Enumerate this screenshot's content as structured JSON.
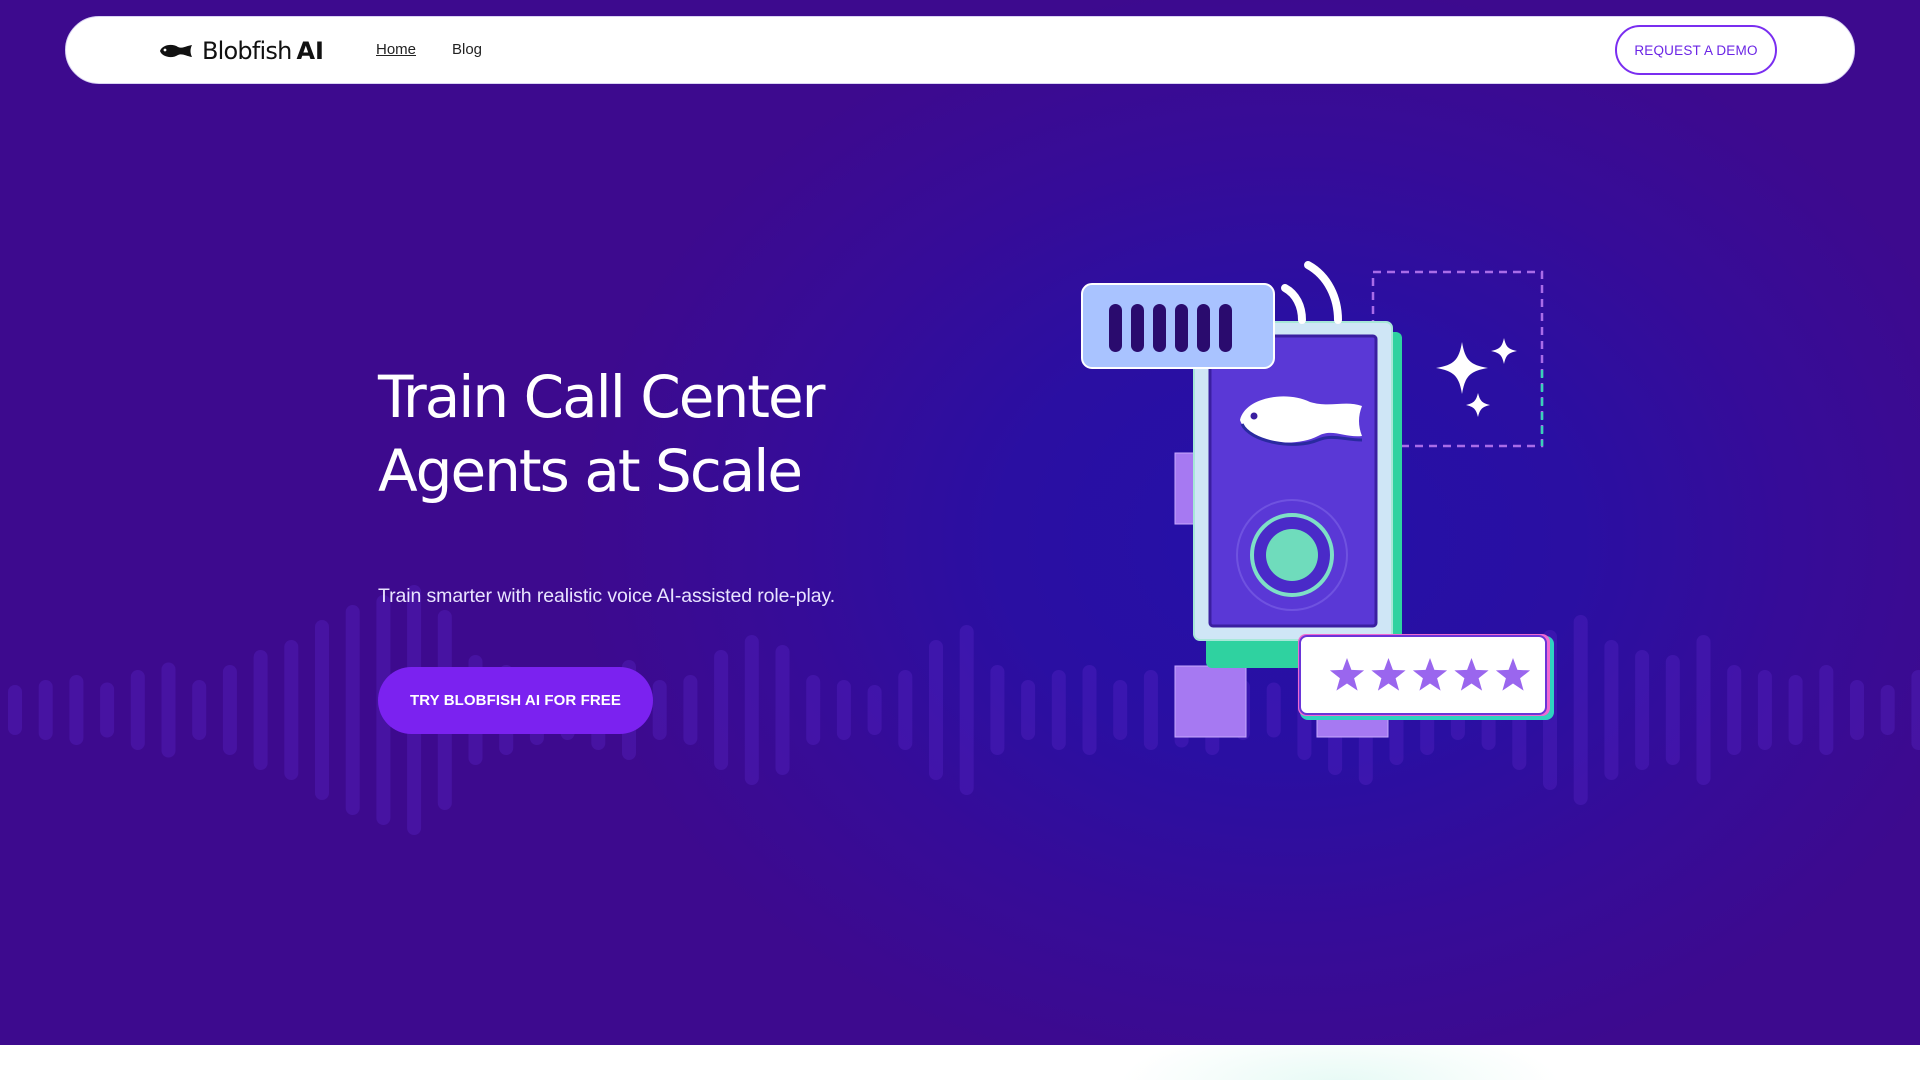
{
  "brand": {
    "name": "Blobfish",
    "suffix": "AI"
  },
  "nav": {
    "home": "Home",
    "blog": "Blog",
    "demo_button": "REQUEST A DEMO"
  },
  "hero": {
    "title_line1": "Train Call Center",
    "title_line2": "Agents at Scale",
    "subtitle": "Train smarter with realistic voice AI-assisted role-play.",
    "cta": "TRY BLOBFISH AI FOR FREE"
  },
  "illustration": {
    "rating_stars": 5
  },
  "colors": {
    "hero_background": "#3a0b92",
    "accent_purple": "#7b22f0",
    "phone_screen": "#5a38d6",
    "phone_frame_mint": "#2fd2a0",
    "speech_bubble": "#a9c3ff",
    "checker_purple": "#a679f2"
  }
}
